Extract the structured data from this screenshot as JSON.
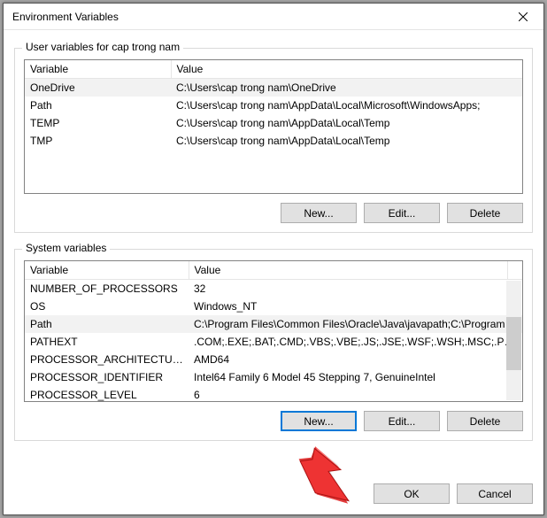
{
  "window": {
    "title": "Environment Variables"
  },
  "userSection": {
    "legend": "User variables for cap trong nam",
    "headers": {
      "col1": "Variable",
      "col2": "Value"
    },
    "rows": [
      {
        "name": "OneDrive",
        "value": "C:\\Users\\cap trong nam\\OneDrive",
        "selected": true
      },
      {
        "name": "Path",
        "value": "C:\\Users\\cap trong nam\\AppData\\Local\\Microsoft\\WindowsApps;",
        "selected": false
      },
      {
        "name": "TEMP",
        "value": "C:\\Users\\cap trong nam\\AppData\\Local\\Temp",
        "selected": false
      },
      {
        "name": "TMP",
        "value": "C:\\Users\\cap trong nam\\AppData\\Local\\Temp",
        "selected": false
      }
    ],
    "buttons": {
      "new": "New...",
      "edit": "Edit...",
      "delete": "Delete"
    }
  },
  "systemSection": {
    "legend": "System variables",
    "headers": {
      "col1": "Variable",
      "col2": "Value"
    },
    "rows": [
      {
        "name": "NUMBER_OF_PROCESSORS",
        "value": "32",
        "selected": false
      },
      {
        "name": "OS",
        "value": "Windows_NT",
        "selected": false
      },
      {
        "name": "Path",
        "value": "C:\\Program Files\\Common Files\\Oracle\\Java\\javapath;C:\\Program ...",
        "selected": true
      },
      {
        "name": "PATHEXT",
        "value": ".COM;.EXE;.BAT;.CMD;.VBS;.VBE;.JS;.JSE;.WSF;.WSH;.MSC;.PY;.PYW",
        "selected": false
      },
      {
        "name": "PROCESSOR_ARCHITECTURE",
        "value": "AMD64",
        "selected": false
      },
      {
        "name": "PROCESSOR_IDENTIFIER",
        "value": "Intel64 Family 6 Model 45 Stepping 7, GenuineIntel",
        "selected": false
      },
      {
        "name": "PROCESSOR_LEVEL",
        "value": "6",
        "selected": false
      }
    ],
    "buttons": {
      "new": "New...",
      "edit": "Edit...",
      "delete": "Delete"
    }
  },
  "dialogButtons": {
    "ok": "OK",
    "cancel": "Cancel"
  }
}
